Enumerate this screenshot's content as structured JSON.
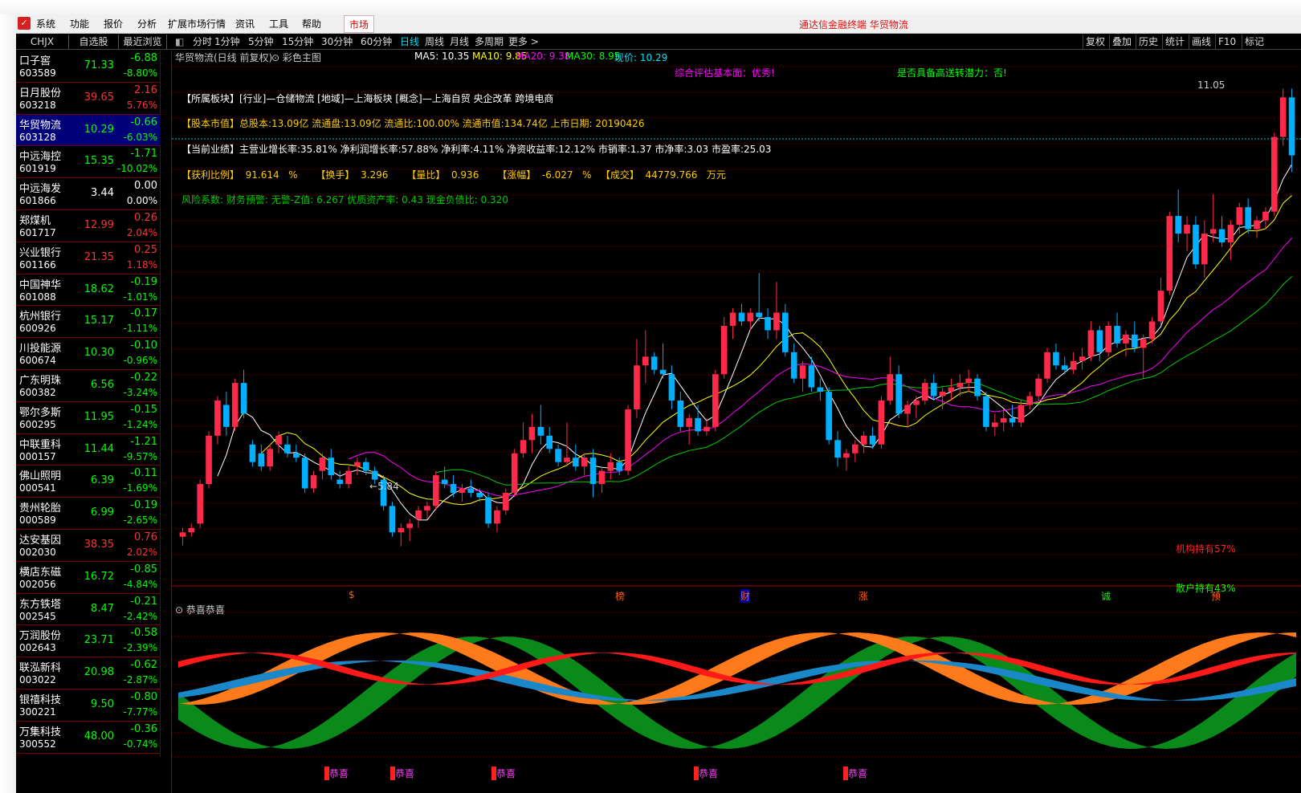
{
  "menubar": {
    "logo": "",
    "items": [
      "系统",
      "功能",
      "报价",
      "分析",
      "扩展市场行情",
      "资讯",
      "工具",
      "帮助"
    ],
    "market_tab": "市场",
    "title": "通达信金融终端  华贸物流"
  },
  "left_tabs": [
    "CHJX",
    "自选股",
    "最近浏览"
  ],
  "period_tabs": [
    "分时",
    "1分钟",
    "5分钟",
    "15分钟",
    "30分钟",
    "60分钟",
    "日线",
    "周线",
    "月线",
    "多周期",
    "更多 >"
  ],
  "active_period": "日线",
  "right_tabs": [
    "复权",
    "叠加",
    "历史",
    "统计",
    "画线",
    "F10",
    "标记"
  ],
  "stocks": [
    {
      "name": "口子窖",
      "code": "603589",
      "price": "71.33",
      "change": "-6.88",
      "pct": "-8.80%",
      "dir": "down"
    },
    {
      "name": "日月股份",
      "code": "603218",
      "price": "39.65",
      "change": "2.16",
      "pct": "5.76%",
      "dir": "up"
    },
    {
      "name": "华贸物流",
      "code": "603128",
      "price": "10.29",
      "change": "-0.66",
      "pct": "-6.03%",
      "dir": "down",
      "selected": true
    },
    {
      "name": "中远海控",
      "code": "601919",
      "price": "15.35",
      "change": "-1.71",
      "pct": "-10.02%",
      "dir": "down"
    },
    {
      "name": "中远海发",
      "code": "601866",
      "price": "3.44",
      "change": "0.00",
      "pct": "0.00%",
      "dir": "flat"
    },
    {
      "name": "郑煤机",
      "code": "601717",
      "price": "12.99",
      "change": "0.26",
      "pct": "2.04%",
      "dir": "up"
    },
    {
      "name": "兴业银行",
      "code": "601166",
      "price": "21.35",
      "change": "0.25",
      "pct": "1.18%",
      "dir": "up"
    },
    {
      "name": "中国神华",
      "code": "601088",
      "price": "18.62",
      "change": "-0.19",
      "pct": "-1.01%",
      "dir": "down"
    },
    {
      "name": "杭州银行",
      "code": "600926",
      "price": "15.17",
      "change": "-0.17",
      "pct": "-1.11%",
      "dir": "down"
    },
    {
      "name": "川投能源",
      "code": "600674",
      "price": "10.30",
      "change": "-0.10",
      "pct": "-0.96%",
      "dir": "down"
    },
    {
      "name": "广东明珠",
      "code": "600382",
      "price": "6.56",
      "change": "-0.22",
      "pct": "-3.24%",
      "dir": "down"
    },
    {
      "name": "鄂尔多斯",
      "code": "600295",
      "price": "11.95",
      "change": "-0.15",
      "pct": "-1.24%",
      "dir": "down"
    },
    {
      "name": "中联重科",
      "code": "000157",
      "price": "11.44",
      "change": "-1.21",
      "pct": "-9.57%",
      "dir": "down"
    },
    {
      "name": "佛山照明",
      "code": "000541",
      "price": "6.39",
      "change": "-0.11",
      "pct": "-1.69%",
      "dir": "down"
    },
    {
      "name": "贵州轮胎",
      "code": "000589",
      "price": "6.99",
      "change": "-0.19",
      "pct": "-2.65%",
      "dir": "down"
    },
    {
      "name": "达安基因",
      "code": "002030",
      "price": "38.35",
      "change": "0.76",
      "pct": "2.02%",
      "dir": "up"
    },
    {
      "name": "横店东磁",
      "code": "002056",
      "price": "16.72",
      "change": "-0.85",
      "pct": "-4.84%",
      "dir": "down"
    },
    {
      "name": "东方铁塔",
      "code": "002545",
      "price": "8.47",
      "change": "-0.21",
      "pct": "-2.42%",
      "dir": "down"
    },
    {
      "name": "万润股份",
      "code": "002643",
      "price": "23.71",
      "change": "-0.58",
      "pct": "-2.39%",
      "dir": "down"
    },
    {
      "name": "联泓新科",
      "code": "003022",
      "price": "20.98",
      "change": "-0.62",
      "pct": "-2.87%",
      "dir": "down"
    },
    {
      "name": "银禧科技",
      "code": "300221",
      "price": "9.50",
      "change": "-0.80",
      "pct": "-7.77%",
      "dir": "down"
    },
    {
      "name": "万集科技",
      "code": "300552",
      "price": "48.00",
      "change": "-0.36",
      "pct": "-0.74%",
      "dir": "down"
    }
  ],
  "chart_header": {
    "title": "华贸物流(日线 前复权)",
    "style": "彩色主图",
    "ma5": "MA5: 10.35",
    "ma10": "MA10: 9.85",
    "ma20": "MA20: 9.38",
    "ma30": "MA30: 8.95",
    "price": "现价: 10.29"
  },
  "info": {
    "eval": "综合评估基本面：优秀!",
    "bonus": "是否具备高送转潜力：否!",
    "l1": "【所属板块】[行业]—仓储物流 [地域]—上海板块 [概念]—上海自贸 央企改革 跨境电商",
    "l2": "【股本市值】总股本:13.09亿 流通盘:13.09亿 流通比:100.00% 流通市值:134.74亿 上市日期: 20190426",
    "l3": "【当前业绩】主营业增长率:35.81% 净利润增长率:57.88% 净利率:4.11% 净资收益率:12.12% 市销率:1.37 市净率:3.03 市盈率:25.03",
    "l4a": "【获利比例】",
    "l4b": "91.614",
    "l4c": "%",
    "l4d": "【换手】",
    "l4e": "3.296",
    "l4f": "【量比】",
    "l4g": "0.936",
    "l4h": "【涨幅】",
    "l4i": "-6.027",
    "l4j": "%",
    "l4k": "【成交】",
    "l4l": "44779.766",
    "l4m": "万元",
    "l5": "风险系数: 财务预警: 无警-Z值: 6.267 优质资产率: 0.43 现金负债比: 0.320"
  },
  "annotations": {
    "high": "11.05",
    "low": "5.84",
    "inst": "机构持有57%",
    "retail": "散户持有43%",
    "markers": [
      "$",
      "榜",
      "财",
      "涨",
      "诚",
      "预"
    ]
  },
  "sub_title": "恭喜恭喜",
  "sub_markers": [
    "恭喜",
    "恭喜",
    "恭喜",
    "恭喜",
    "恭喜"
  ],
  "colors": {
    "up": "#ff3232",
    "down": "#00ff00",
    "flat": "#ffffff",
    "candle_up": "#ff2a4a",
    "candle_down": "#00b0ff",
    "ma5": "#ffffff",
    "ma10": "#ffff00",
    "ma20": "#ff00ff",
    "ma30": "#00cc00"
  },
  "chart_data": {
    "type": "candlestick",
    "title": "华贸物流(日线 前复权)",
    "ylim": [
      5.5,
      11.3
    ],
    "candles": [
      {
        "o": 5.95,
        "h": 6.05,
        "l": 5.85,
        "c": 6.0
      },
      {
        "o": 6.0,
        "h": 6.1,
        "l": 5.95,
        "c": 6.05
      },
      {
        "o": 6.1,
        "h": 6.6,
        "l": 6.05,
        "c": 6.55
      },
      {
        "o": 6.55,
        "h": 7.15,
        "l": 6.5,
        "c": 7.1
      },
      {
        "o": 7.1,
        "h": 7.55,
        "l": 7.0,
        "c": 7.5
      },
      {
        "o": 7.45,
        "h": 7.6,
        "l": 7.1,
        "c": 7.2
      },
      {
        "o": 7.2,
        "h": 7.75,
        "l": 7.15,
        "c": 7.7
      },
      {
        "o": 7.7,
        "h": 7.85,
        "l": 7.3,
        "c": 7.35
      },
      {
        "o": 7.0,
        "h": 7.05,
        "l": 6.75,
        "c": 6.8
      },
      {
        "o": 6.9,
        "h": 7.0,
        "l": 6.7,
        "c": 6.75
      },
      {
        "o": 6.75,
        "h": 7.0,
        "l": 6.7,
        "c": 6.95
      },
      {
        "o": 7.0,
        "h": 7.15,
        "l": 6.9,
        "c": 7.1
      },
      {
        "o": 7.0,
        "h": 7.1,
        "l": 6.85,
        "c": 6.9
      },
      {
        "o": 6.9,
        "h": 7.0,
        "l": 6.8,
        "c": 6.85
      },
      {
        "o": 6.85,
        "h": 6.9,
        "l": 6.45,
        "c": 6.5
      },
      {
        "o": 6.5,
        "h": 6.7,
        "l": 6.45,
        "c": 6.65
      },
      {
        "o": 6.7,
        "h": 6.9,
        "l": 6.6,
        "c": 6.85
      },
      {
        "o": 6.85,
        "h": 6.95,
        "l": 6.6,
        "c": 6.65
      },
      {
        "o": 6.6,
        "h": 6.7,
        "l": 6.5,
        "c": 6.55
      },
      {
        "o": 6.55,
        "h": 6.75,
        "l": 6.5,
        "c": 6.7
      },
      {
        "o": 6.75,
        "h": 6.85,
        "l": 6.65,
        "c": 6.8
      },
      {
        "o": 6.8,
        "h": 6.85,
        "l": 6.65,
        "c": 6.7
      },
      {
        "o": 6.7,
        "h": 6.75,
        "l": 6.55,
        "c": 6.6
      },
      {
        "o": 6.6,
        "h": 6.65,
        "l": 6.25,
        "c": 6.3
      },
      {
        "o": 6.3,
        "h": 6.35,
        "l": 5.95,
        "c": 6.0
      },
      {
        "o": 6.0,
        "h": 6.1,
        "l": 5.84,
        "c": 6.05
      },
      {
        "o": 6.05,
        "h": 6.15,
        "l": 5.9,
        "c": 6.1
      },
      {
        "o": 6.15,
        "h": 6.3,
        "l": 6.05,
        "c": 6.25
      },
      {
        "o": 6.25,
        "h": 6.35,
        "l": 6.15,
        "c": 6.3
      },
      {
        "o": 6.3,
        "h": 6.7,
        "l": 6.25,
        "c": 6.65
      },
      {
        "o": 6.6,
        "h": 6.75,
        "l": 6.5,
        "c": 6.55
      },
      {
        "o": 6.55,
        "h": 6.65,
        "l": 6.4,
        "c": 6.45
      },
      {
        "o": 6.45,
        "h": 6.55,
        "l": 6.35,
        "c": 6.5
      },
      {
        "o": 6.5,
        "h": 6.6,
        "l": 6.4,
        "c": 6.45
      },
      {
        "o": 6.45,
        "h": 6.5,
        "l": 6.35,
        "c": 6.4
      },
      {
        "o": 6.4,
        "h": 6.45,
        "l": 6.05,
        "c": 6.1
      },
      {
        "o": 6.1,
        "h": 6.3,
        "l": 6.0,
        "c": 6.25
      },
      {
        "o": 6.25,
        "h": 6.5,
        "l": 6.2,
        "c": 6.45
      },
      {
        "o": 6.45,
        "h": 6.95,
        "l": 6.4,
        "c": 6.9
      },
      {
        "o": 6.9,
        "h": 7.25,
        "l": 6.85,
        "c": 7.05
      },
      {
        "o": 7.05,
        "h": 7.35,
        "l": 6.9,
        "c": 7.2
      },
      {
        "o": 7.2,
        "h": 7.45,
        "l": 7.0,
        "c": 7.1
      },
      {
        "o": 7.1,
        "h": 7.2,
        "l": 6.9,
        "c": 6.95
      },
      {
        "o": 6.95,
        "h": 7.0,
        "l": 6.75,
        "c": 6.8
      },
      {
        "o": 6.8,
        "h": 7.25,
        "l": 6.75,
        "c": 6.85
      },
      {
        "o": 6.85,
        "h": 7.0,
        "l": 6.7,
        "c": 6.75
      },
      {
        "o": 6.75,
        "h": 6.9,
        "l": 6.65,
        "c": 6.85
      },
      {
        "o": 6.85,
        "h": 6.95,
        "l": 6.4,
        "c": 6.55
      },
      {
        "o": 6.55,
        "h": 6.75,
        "l": 6.45,
        "c": 6.7
      },
      {
        "o": 6.7,
        "h": 6.9,
        "l": 6.6,
        "c": 6.8
      },
      {
        "o": 6.8,
        "h": 6.85,
        "l": 6.65,
        "c": 6.7
      },
      {
        "o": 6.7,
        "h": 7.45,
        "l": 6.65,
        "c": 7.4
      },
      {
        "o": 7.4,
        "h": 8.2,
        "l": 7.3,
        "c": 7.9
      },
      {
        "o": 7.9,
        "h": 8.3,
        "l": 7.7,
        "c": 8.0
      },
      {
        "o": 8.0,
        "h": 8.05,
        "l": 7.8,
        "c": 7.85
      },
      {
        "o": 7.85,
        "h": 8.15,
        "l": 7.75,
        "c": 7.8
      },
      {
        "o": 7.8,
        "h": 7.9,
        "l": 7.4,
        "c": 7.5
      },
      {
        "o": 7.5,
        "h": 7.6,
        "l": 7.15,
        "c": 7.2
      },
      {
        "o": 7.2,
        "h": 7.35,
        "l": 7.0,
        "c": 7.3
      },
      {
        "o": 7.3,
        "h": 7.45,
        "l": 7.1,
        "c": 7.15
      },
      {
        "o": 7.15,
        "h": 7.3,
        "l": 7.1,
        "c": 7.2
      },
      {
        "o": 7.2,
        "h": 7.85,
        "l": 7.15,
        "c": 7.8
      },
      {
        "o": 7.8,
        "h": 8.45,
        "l": 7.75,
        "c": 8.35
      },
      {
        "o": 8.35,
        "h": 8.55,
        "l": 8.2,
        "c": 8.5
      },
      {
        "o": 8.5,
        "h": 8.6,
        "l": 8.35,
        "c": 8.4
      },
      {
        "o": 8.4,
        "h": 8.55,
        "l": 8.3,
        "c": 8.5
      },
      {
        "o": 8.5,
        "h": 8.95,
        "l": 8.4,
        "c": 8.45
      },
      {
        "o": 8.45,
        "h": 8.55,
        "l": 8.2,
        "c": 8.3
      },
      {
        "o": 8.3,
        "h": 8.85,
        "l": 8.2,
        "c": 8.5
      },
      {
        "o": 8.5,
        "h": 8.6,
        "l": 8.0,
        "c": 8.05
      },
      {
        "o": 8.05,
        "h": 8.15,
        "l": 7.7,
        "c": 7.75
      },
      {
        "o": 7.75,
        "h": 7.95,
        "l": 7.6,
        "c": 7.9
      },
      {
        "o": 7.9,
        "h": 8.0,
        "l": 7.6,
        "c": 7.65
      },
      {
        "o": 7.65,
        "h": 7.75,
        "l": 7.5,
        "c": 7.6
      },
      {
        "o": 7.6,
        "h": 7.65,
        "l": 7.0,
        "c": 7.05
      },
      {
        "o": 7.05,
        "h": 7.15,
        "l": 6.75,
        "c": 6.85
      },
      {
        "o": 6.85,
        "h": 6.95,
        "l": 6.7,
        "c": 6.9
      },
      {
        "o": 6.9,
        "h": 7.05,
        "l": 6.8,
        "c": 7.0
      },
      {
        "o": 7.0,
        "h": 7.15,
        "l": 6.9,
        "c": 7.1
      },
      {
        "o": 7.1,
        "h": 7.2,
        "l": 6.95,
        "c": 7.0
      },
      {
        "o": 7.0,
        "h": 7.55,
        "l": 6.95,
        "c": 7.5
      },
      {
        "o": 7.5,
        "h": 8.0,
        "l": 7.45,
        "c": 7.8
      },
      {
        "o": 7.8,
        "h": 7.9,
        "l": 7.3,
        "c": 7.35
      },
      {
        "o": 7.35,
        "h": 7.5,
        "l": 7.2,
        "c": 7.45
      },
      {
        "o": 7.45,
        "h": 7.55,
        "l": 7.3,
        "c": 7.5
      },
      {
        "o": 7.5,
        "h": 7.75,
        "l": 7.45,
        "c": 7.7
      },
      {
        "o": 7.7,
        "h": 7.8,
        "l": 7.5,
        "c": 7.55
      },
      {
        "o": 7.55,
        "h": 7.65,
        "l": 7.4,
        "c": 7.6
      },
      {
        "o": 7.6,
        "h": 7.75,
        "l": 7.5,
        "c": 7.65
      },
      {
        "o": 7.65,
        "h": 7.8,
        "l": 7.55,
        "c": 7.7
      },
      {
        "o": 7.7,
        "h": 7.85,
        "l": 7.6,
        "c": 7.75
      },
      {
        "o": 7.75,
        "h": 7.8,
        "l": 7.5,
        "c": 7.55
      },
      {
        "o": 7.55,
        "h": 7.6,
        "l": 7.15,
        "c": 7.2
      },
      {
        "o": 7.2,
        "h": 7.35,
        "l": 7.1,
        "c": 7.25
      },
      {
        "o": 7.25,
        "h": 7.4,
        "l": 7.15,
        "c": 7.3
      },
      {
        "o": 7.3,
        "h": 7.45,
        "l": 7.2,
        "c": 7.25
      },
      {
        "o": 7.25,
        "h": 7.5,
        "l": 7.2,
        "c": 7.45
      },
      {
        "o": 7.45,
        "h": 7.6,
        "l": 7.4,
        "c": 7.55
      },
      {
        "o": 7.55,
        "h": 7.8,
        "l": 7.5,
        "c": 7.75
      },
      {
        "o": 7.75,
        "h": 8.1,
        "l": 7.7,
        "c": 8.05
      },
      {
        "o": 8.05,
        "h": 8.15,
        "l": 7.85,
        "c": 7.9
      },
      {
        "o": 7.9,
        "h": 8.0,
        "l": 7.8,
        "c": 7.85
      },
      {
        "o": 7.85,
        "h": 8.05,
        "l": 7.8,
        "c": 7.95
      },
      {
        "o": 7.95,
        "h": 8.1,
        "l": 7.85,
        "c": 8.0
      },
      {
        "o": 8.0,
        "h": 8.4,
        "l": 7.95,
        "c": 8.3
      },
      {
        "o": 8.3,
        "h": 8.35,
        "l": 7.95,
        "c": 8.05
      },
      {
        "o": 8.05,
        "h": 8.4,
        "l": 8.0,
        "c": 8.35
      },
      {
        "o": 8.35,
        "h": 8.5,
        "l": 8.1,
        "c": 8.15
      },
      {
        "o": 8.15,
        "h": 8.3,
        "l": 8.0,
        "c": 8.25
      },
      {
        "o": 8.25,
        "h": 8.4,
        "l": 8.05,
        "c": 8.1
      },
      {
        "o": 8.1,
        "h": 8.25,
        "l": 7.75,
        "c": 8.2
      },
      {
        "o": 8.2,
        "h": 8.45,
        "l": 8.15,
        "c": 8.4
      },
      {
        "o": 8.4,
        "h": 8.9,
        "l": 8.35,
        "c": 8.75
      },
      {
        "o": 8.75,
        "h": 9.65,
        "l": 8.7,
        "c": 9.6
      },
      {
        "o": 9.6,
        "h": 9.9,
        "l": 9.3,
        "c": 9.4
      },
      {
        "o": 9.4,
        "h": 9.6,
        "l": 9.2,
        "c": 9.5
      },
      {
        "o": 9.5,
        "h": 9.6,
        "l": 9.0,
        "c": 9.05
      },
      {
        "o": 9.05,
        "h": 9.55,
        "l": 8.9,
        "c": 9.4
      },
      {
        "o": 9.4,
        "h": 9.85,
        "l": 9.3,
        "c": 9.45
      },
      {
        "o": 9.45,
        "h": 9.6,
        "l": 9.25,
        "c": 9.3
      },
      {
        "o": 9.3,
        "h": 9.55,
        "l": 9.1,
        "c": 9.5
      },
      {
        "o": 9.5,
        "h": 9.75,
        "l": 9.4,
        "c": 9.7
      },
      {
        "o": 9.7,
        "h": 9.8,
        "l": 9.4,
        "c": 9.45
      },
      {
        "o": 9.45,
        "h": 9.6,
        "l": 9.35,
        "c": 9.55
      },
      {
        "o": 9.55,
        "h": 9.7,
        "l": 9.45,
        "c": 9.65
      },
      {
        "o": 9.65,
        "h": 10.55,
        "l": 9.6,
        "c": 10.5
      },
      {
        "o": 10.5,
        "h": 11.05,
        "l": 10.4,
        "c": 10.95
      },
      {
        "o": 10.95,
        "h": 11.05,
        "l": 10.1,
        "c": 10.29
      }
    ]
  }
}
